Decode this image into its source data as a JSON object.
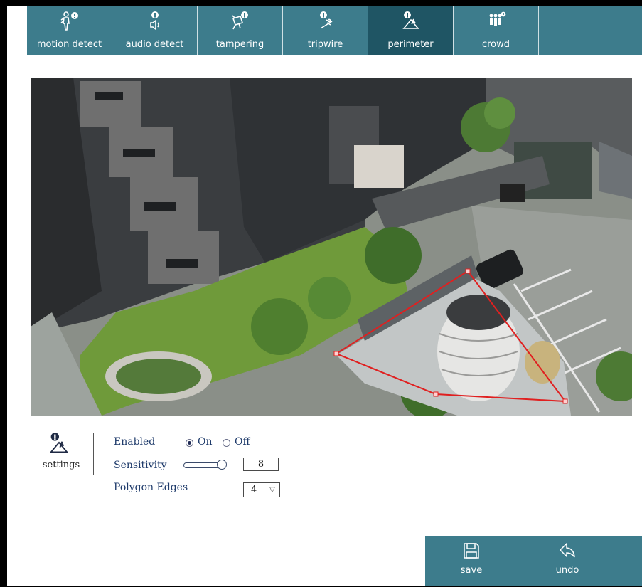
{
  "tabs": [
    {
      "id": "motion-detect",
      "label": "motion detect",
      "icon": "motion-detect-icon"
    },
    {
      "id": "audio-detect",
      "label": "audio detect",
      "icon": "audio-detect-icon"
    },
    {
      "id": "tampering",
      "label": "tampering",
      "icon": "tampering-icon"
    },
    {
      "id": "tripwire",
      "label": "tripwire",
      "icon": "tripwire-icon"
    },
    {
      "id": "perimeter",
      "label": "perimeter",
      "icon": "perimeter-icon",
      "active": true
    },
    {
      "id": "crowd",
      "label": "crowd",
      "icon": "crowd-icon"
    }
  ],
  "settings": {
    "label": "settings",
    "icon": "perimeter-settings-icon",
    "enabled_label": "Enabled",
    "enabled_on_label": "On",
    "enabled_off_label": "Off",
    "enabled_value": "On",
    "sensitivity_label": "Sensitivity",
    "sensitivity_value": "8",
    "polygon_edges_label": "Polygon Edges",
    "polygon_edges_value": "4"
  },
  "actions": {
    "save_label": "save",
    "undo_label": "undo"
  },
  "colors": {
    "tab_bar": "#3d7c8c",
    "tab_active": "#1f5564",
    "perimeter_line": "#e02020"
  }
}
